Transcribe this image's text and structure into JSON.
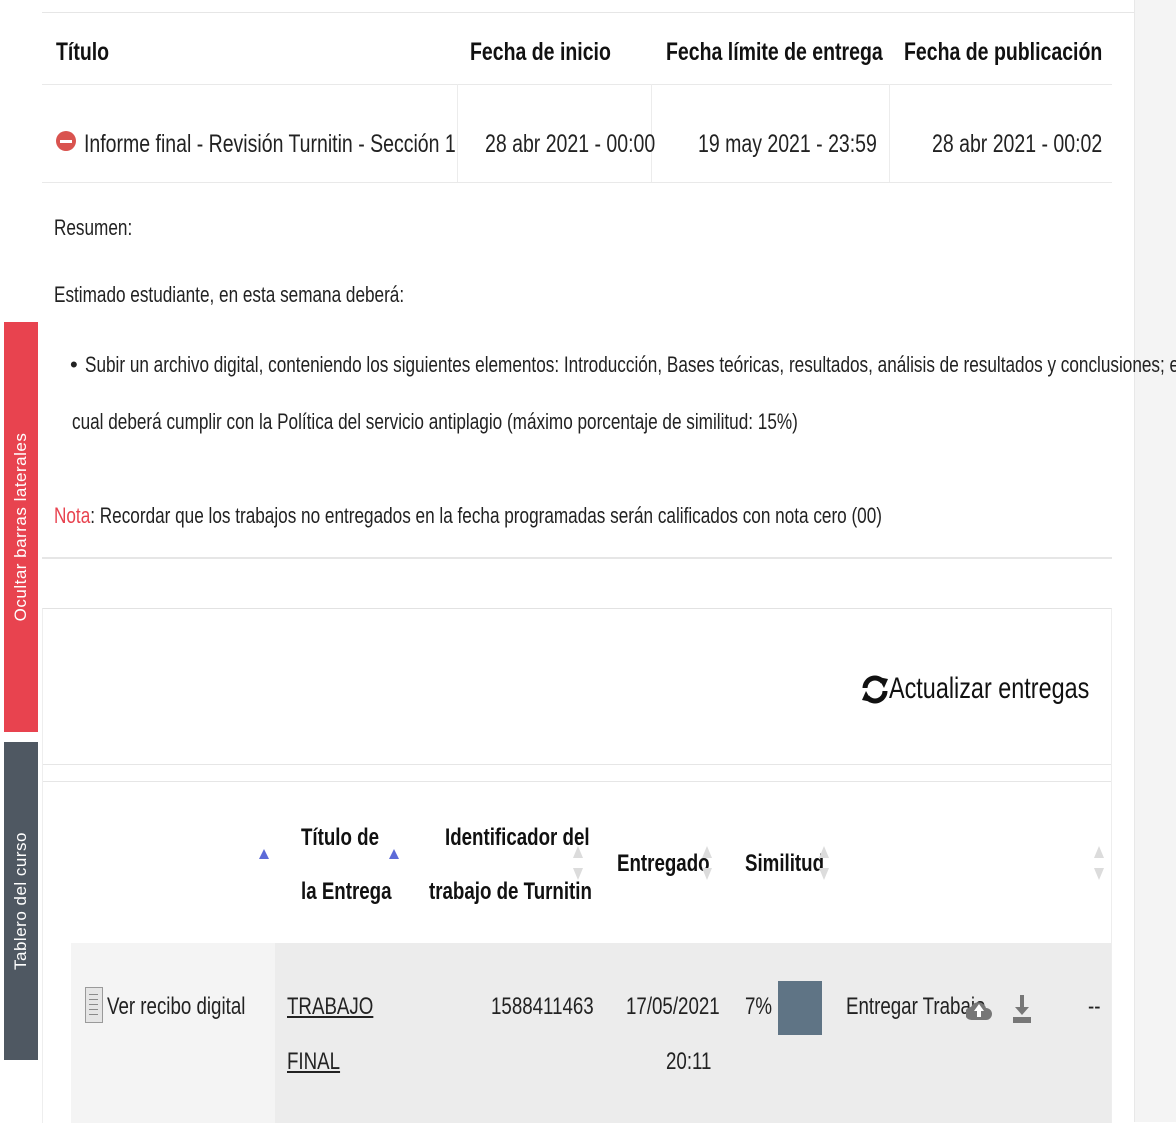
{
  "sidebar_tabs": {
    "hide_sidebars": "Ocultar barras laterales",
    "course_dashboard": "Tablero del curso"
  },
  "assignment": {
    "headers": {
      "title": "Título",
      "start": "Fecha de inicio",
      "due": "Fecha límite de entrega",
      "post": "Fecha de publicación"
    },
    "row": {
      "title": "Informe final - Revisión Turnitin - Sección 1",
      "start": "28 abr 2021 - 00:00",
      "due": "19 may 2021 - 23:59",
      "post": "28 abr 2021 - 00:02"
    },
    "summary_label": "Resumen:",
    "intro": "Estimado estudiante, en esta semana deberá:",
    "bullet_line1": "Subir un archivo digital, conteniendo los siguientes elementos: Introducción, Bases teóricas, resultados, análisis de resultados y conclusiones; el",
    "bullet_line2": "cual deberá cumplir con la Política del servicio antiplagio (máximo porcentaje de similitud: 15%)",
    "note_label": "Nota",
    "note_text": ": Recordar que los trabajos no entregados en la fecha programadas serán calificados con nota cero (00)"
  },
  "submissions": {
    "refresh_label": "Actualizar entregas",
    "columns": {
      "title_l1": "Título de",
      "title_l2": "la Entrega",
      "id_l1": "Identificador del",
      "id_l2": "trabajo de Turnitin",
      "submitted": "Entregado",
      "similarity": "Similitud"
    },
    "row": {
      "receipt": "Ver recibo digital",
      "title_l1": "TRABAJO",
      "title_l2": "FINAL",
      "paper_id": "1588411463",
      "date": "17/05/2021",
      "time": "20:11",
      "similarity": "7%",
      "submit_label": "Entregar Trabajo",
      "last": "--"
    }
  },
  "colors": {
    "hide_tab": "#e8434f",
    "dashboard_tab": "#4f5862",
    "sort_active": "#5c6ad8",
    "similarity_box": "#5f7485",
    "nota": "#e8434f"
  }
}
